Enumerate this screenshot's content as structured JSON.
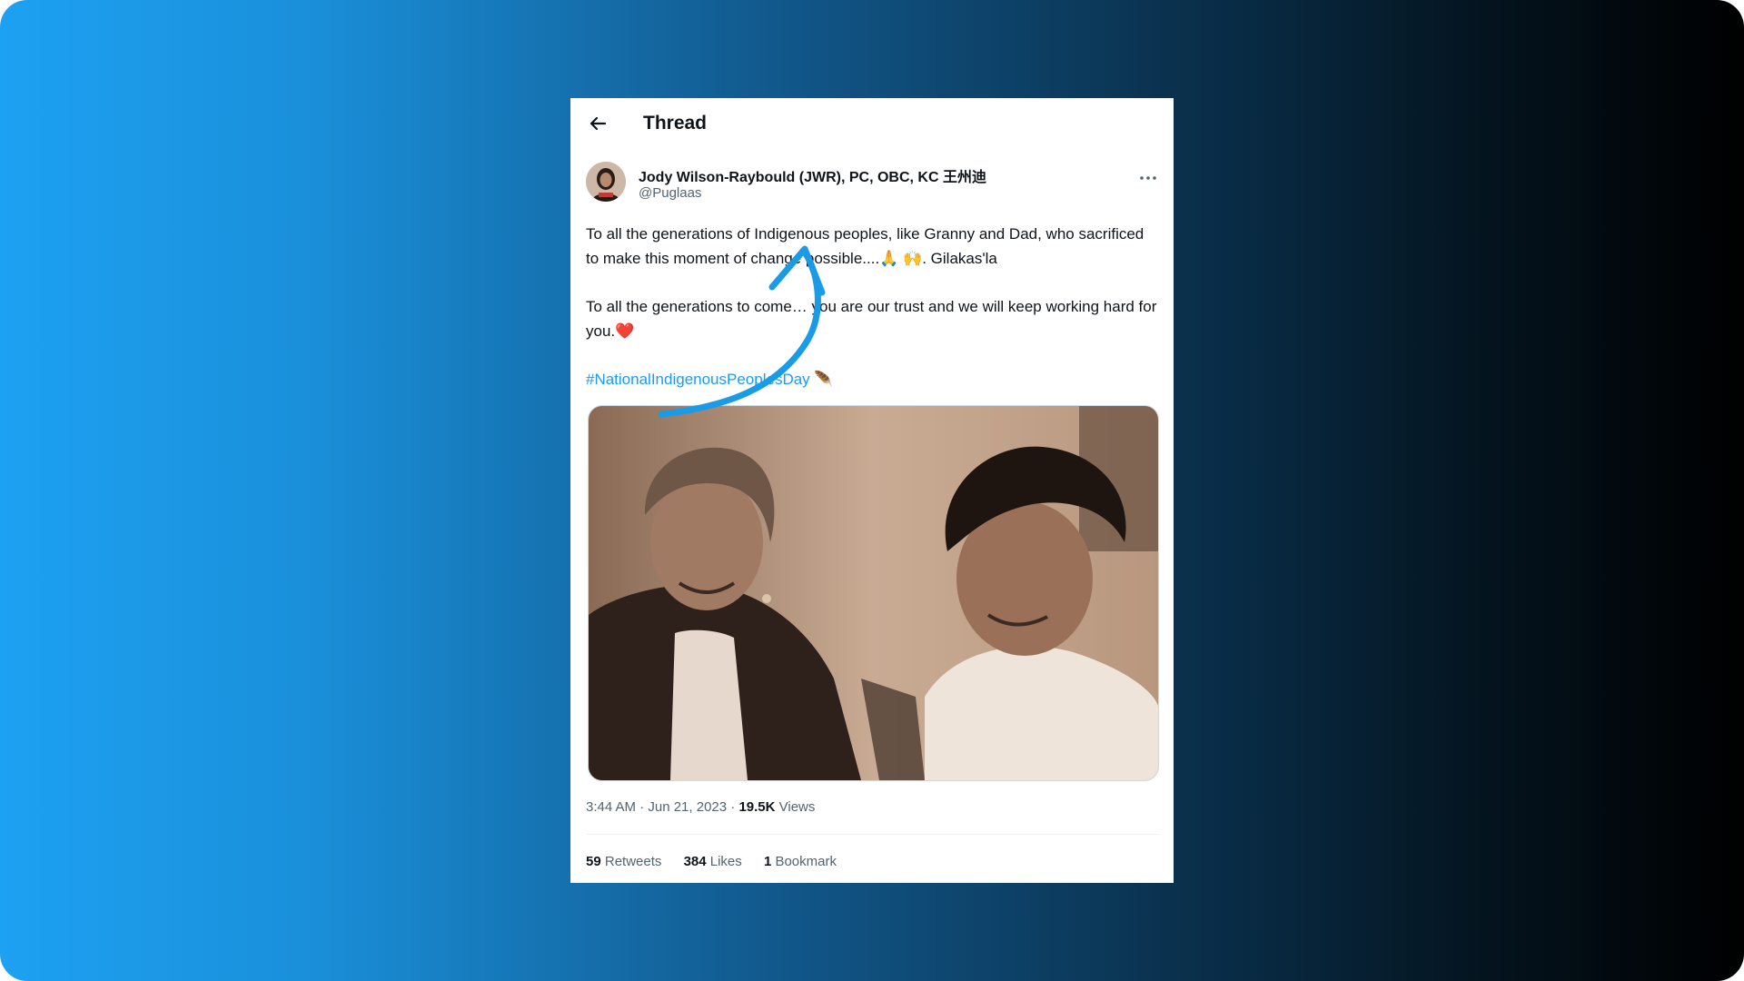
{
  "header": {
    "title": "Thread",
    "back_icon": "arrow-left-icon"
  },
  "tweet": {
    "author_name": "Jody Wilson-Raybould (JWR), PC, OBC, KC 王州迪",
    "handle": "@Puglaas",
    "more_icon": "ellipsis-icon",
    "paragraph1": "To all the generations of Indigenous peoples, like Granny and Dad, who sacrificed to make this moment of change possible....🙏 🙌. Gilakas'la",
    "paragraph2": "To all the generations to come… you are our trust and we will keep working hard for you.❤️",
    "hashtag": "#NationalIndigenousPeoplesDay",
    "hashtag_emoji": "🪶",
    "time": "3:44 AM · Jun 21, 2023 · ",
    "views_count": "19.5K",
    "views_label": " Views",
    "retweets_count": "59",
    "retweets_label": " Retweets",
    "likes_count": "384",
    "likes_label": " Likes",
    "bookmarks_count": "1",
    "bookmarks_label": " Bookmark"
  },
  "colors": {
    "accent": "#1d9bf0",
    "annotation_arrow": "#1a9be6",
    "heart": "#e0245e"
  }
}
